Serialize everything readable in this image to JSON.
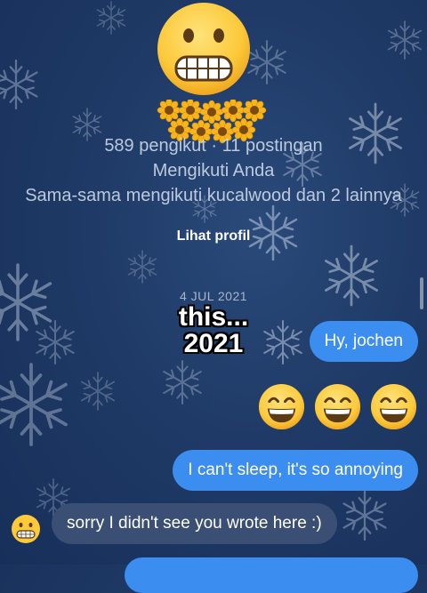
{
  "profile": {
    "stats": "589 pengikut · 11 postingan",
    "follow_status": "Mengikuti Anda",
    "mutuals": "Sama-sama mengikuti kucalwood dan 2 lainnya",
    "view_profile_label": "Lihat profil"
  },
  "thread": {
    "date": "4 JUL 2021",
    "overlay_caption_line1": "this...",
    "overlay_caption_line2": "2021",
    "messages": [
      {
        "sender": "me",
        "text": "Hy, jochen"
      },
      {
        "sender": "me",
        "emoji": "grinning-face-with-smiling-eyes",
        "count": 3
      },
      {
        "sender": "me",
        "text": "I can't sleep, it's so annoying"
      },
      {
        "sender": "them",
        "text": "sorry I didn't see you wrote here :)"
      }
    ]
  },
  "icons": {
    "sticker_top": "grimacing-face",
    "sticker_flowers": "sunflower",
    "avatar": "grimacing-face"
  },
  "colors": {
    "background": "#1f3a66",
    "outgoing_bubble": "#3b8df0",
    "incoming_bubble": "#3a4f73"
  }
}
